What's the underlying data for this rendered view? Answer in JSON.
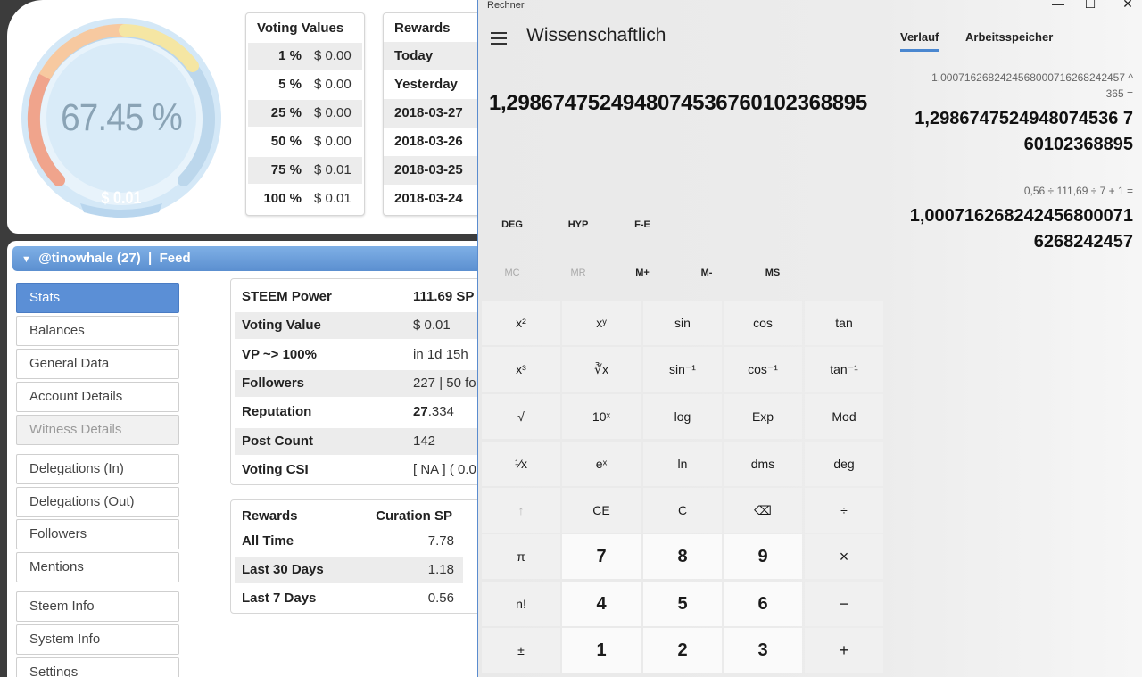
{
  "gauge": {
    "percent": "67.45 %",
    "value": "$ 0.01",
    "fill_fraction": 0.6745
  },
  "voting_values": {
    "title": "Voting Values",
    "rows": [
      {
        "pct": "1 %",
        "val": "$ 0.00"
      },
      {
        "pct": "5 %",
        "val": "$ 0.00"
      },
      {
        "pct": "25 %",
        "val": "$ 0.00"
      },
      {
        "pct": "50 %",
        "val": "$ 0.00"
      },
      {
        "pct": "75 %",
        "val": "$ 0.01"
      },
      {
        "pct": "100 %",
        "val": "$ 0.01"
      }
    ]
  },
  "rewards_top": {
    "title": "Rewards",
    "rows": [
      "Today",
      "Yesterday",
      "2018-03-27",
      "2018-03-26",
      "2018-03-25",
      "2018-03-24"
    ]
  },
  "feed_bar": {
    "user": "@tinowhale (27)",
    "sep": "|",
    "feed": "Feed"
  },
  "sidebar": {
    "items": [
      {
        "label": "Stats"
      },
      {
        "label": "Balances"
      },
      {
        "label": "General Data"
      },
      {
        "label": "Account Details"
      },
      {
        "label": "Witness Details"
      },
      {
        "label": "Delegations (In)"
      },
      {
        "label": "Delegations (Out)"
      },
      {
        "label": "Followers"
      },
      {
        "label": "Mentions"
      },
      {
        "label": "Steem Info"
      },
      {
        "label": "System Info"
      },
      {
        "label": "Settings"
      }
    ]
  },
  "stats": {
    "rows": [
      {
        "key": "STEEM Power",
        "val": "111.69 SP"
      },
      {
        "key": "Voting Value",
        "val": "$ 0.01"
      },
      {
        "key": "VP ~> 100%",
        "val": "in 1d 15h"
      },
      {
        "key": "Followers",
        "val": "227 | 50 fo"
      },
      {
        "key": "Reputation",
        "val_bold": "27",
        "val": ".334"
      },
      {
        "key": "Post Count",
        "val": "142"
      },
      {
        "key": "Voting CSI",
        "val": "[ NA ] ( 0.0"
      }
    ]
  },
  "rewards_bottom": {
    "headers": [
      "Rewards",
      "Curation SP"
    ],
    "rows": [
      {
        "label": "All Time",
        "value": "7.78"
      },
      {
        "label": "Last 30 Days",
        "value": "1.18"
      },
      {
        "label": "Last 7 Days",
        "value": "0.56"
      }
    ]
  },
  "calculator": {
    "window_title": "Rechner",
    "controls": {
      "minimize": "—",
      "maximize": "☐",
      "close": "✕"
    },
    "mode": "Wissenschaftlich",
    "display": "1,2986747524948074536760102368895",
    "flags": [
      "DEG",
      "HYP",
      "F-E"
    ],
    "memory": [
      "MC",
      "MR",
      "M+",
      "M-",
      "MS"
    ],
    "keys": {
      "r1": [
        "x²",
        "xʸ",
        "sin",
        "cos",
        "tan"
      ],
      "r2": [
        "x³",
        "∛x",
        "sin⁻¹",
        "cos⁻¹",
        "tan⁻¹"
      ],
      "r3": [
        "√",
        "10ˣ",
        "log",
        "Exp",
        "Mod"
      ],
      "r4": [
        "¹⁄x",
        "eˣ",
        "ln",
        "dms",
        "deg"
      ],
      "r5": [
        "↑",
        "CE",
        "C",
        "⌫",
        "÷"
      ],
      "r6": [
        "π",
        "7",
        "8",
        "9",
        "×"
      ],
      "r7": [
        "n!",
        "4",
        "5",
        "6",
        "−"
      ],
      "r8": [
        "±",
        "1",
        "2",
        "3",
        "+"
      ]
    },
    "history_tabs": [
      "Verlauf",
      "Arbeitsspeicher"
    ],
    "history": [
      {
        "expr_line1": "1,0007162682424568000716268242457  ^",
        "expr_line2": "365 =",
        "result_line1": "1,2986747524948074536 7",
        "result_line2": "60102368895"
      },
      {
        "expr_line1": "0,56  ÷  111,69  ÷  7  +  1 =",
        "result_line1": "1,0007162682424568000 71",
        "result_line2": "6268242457"
      }
    ],
    "history_display": {
      "h1_r1": "1,2986747524948074536 7",
      "h1_r2": "60102368895",
      "h2_r1": "1,000716268242456800071",
      "h2_r2": "6268242457"
    }
  }
}
